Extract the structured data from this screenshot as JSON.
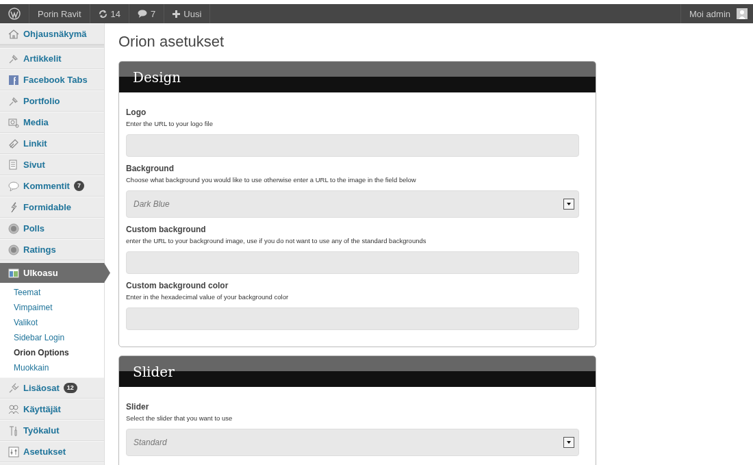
{
  "admin_bar": {
    "site_name": "Porin Ravit",
    "updates": "14",
    "comments": "7",
    "new_label": "Uusi",
    "greeting": "Moi admin"
  },
  "sidebar": {
    "items": [
      {
        "label": "Ohjausnäkymä",
        "kind": "home",
        "selected": false
      },
      {
        "label": "Artikkelit",
        "kind": "pin",
        "selected": false
      },
      {
        "label": "Facebook Tabs",
        "kind": "facebook",
        "selected": false
      },
      {
        "label": "Portfolio",
        "kind": "pin",
        "selected": false
      },
      {
        "label": "Media",
        "kind": "media",
        "selected": false
      },
      {
        "label": "Linkit",
        "kind": "link",
        "selected": false
      },
      {
        "label": "Sivut",
        "kind": "pages",
        "selected": false
      },
      {
        "label": "Kommentit",
        "kind": "comment",
        "badge": "7",
        "selected": false
      },
      {
        "label": "Formidable",
        "kind": "bolt",
        "selected": false
      },
      {
        "label": "Polls",
        "kind": "circle",
        "selected": false
      },
      {
        "label": "Ratings",
        "kind": "circle",
        "selected": false
      },
      {
        "label": "Ulkoasu",
        "kind": "appearance",
        "selected": true,
        "children": [
          {
            "label": "Teemat",
            "selected": false
          },
          {
            "label": "Vimpaimet",
            "selected": false
          },
          {
            "label": "Valikot",
            "selected": false
          },
          {
            "label": "Sidebar Login",
            "selected": false
          },
          {
            "label": "Orion Options",
            "selected": true
          },
          {
            "label": "Muokkain",
            "selected": false
          }
        ]
      },
      {
        "label": "Lisäosat",
        "kind": "plugin",
        "badge": "12",
        "selected": false
      },
      {
        "label": "Käyttäjät",
        "kind": "users",
        "selected": false
      },
      {
        "label": "Työkalut",
        "kind": "tools",
        "selected": false
      },
      {
        "label": "Asetukset",
        "kind": "settings",
        "selected": false
      }
    ]
  },
  "page_title": "Orion asetukset",
  "sections": [
    {
      "title": "Design",
      "fields": [
        {
          "kind": "text",
          "label": "Logo",
          "description": "Enter the URL to your logo file"
        },
        {
          "kind": "select",
          "label": "Background",
          "description": "Choose what background you would like to use otherwise enter a URL to the image in the field below",
          "value": "Dark Blue"
        },
        {
          "kind": "text",
          "label": "Custom background",
          "description": "enter the URL to your background image, use if you do not want to use any of the standard backgrounds"
        },
        {
          "kind": "text",
          "label": "Custom background color",
          "description": "Enter in the hexadecimal value of your background color"
        }
      ]
    },
    {
      "title": "Slider",
      "fields": [
        {
          "kind": "select",
          "label": "Slider",
          "description": "Select the slider that you want to use",
          "value": "Standard"
        }
      ]
    }
  ]
}
